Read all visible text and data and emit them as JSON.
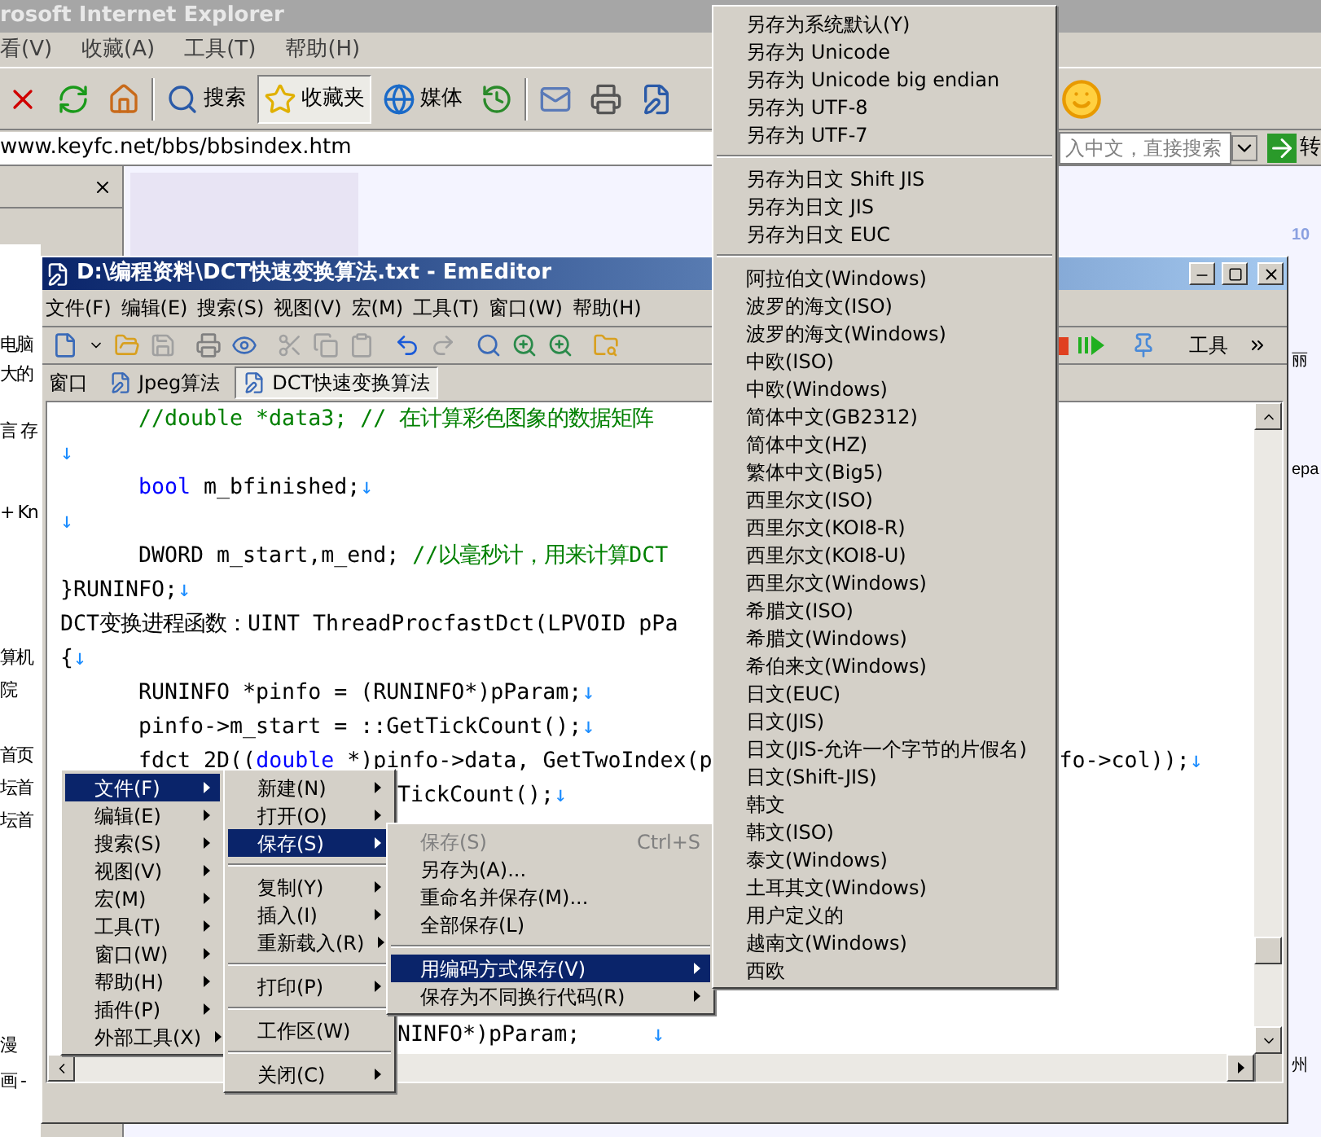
{
  "ie": {
    "title": "rosoft Internet Explorer",
    "menu": [
      "看(V)",
      "收藏(A)",
      "工具(T)",
      "帮助(H)"
    ],
    "toolbar": [
      {
        "kind": "stop"
      },
      {
        "kind": "refresh"
      },
      {
        "kind": "home"
      },
      {
        "kind": "separator"
      },
      {
        "kind": "search",
        "label": "搜索",
        "pressed": false
      },
      {
        "kind": "favorites",
        "label": "收藏夹",
        "pressed": true
      },
      {
        "kind": "media",
        "label": "媒体",
        "pressed": false
      },
      {
        "kind": "history"
      },
      {
        "kind": "separator"
      },
      {
        "kind": "mail"
      },
      {
        "kind": "print"
      },
      {
        "kind": "edit"
      }
    ],
    "address": "www.keyfc.net/bbs/bbsindex.htm",
    "search": {
      "placeholder": "入中文，直接搜索"
    },
    "go": "转",
    "left_fragments": [
      "电脑",
      "大的",
      "言 存",
      "+ Kn",
      "算机",
      "院",
      "首页",
      "坛首",
      "坛首",
      "漫",
      "画 -"
    ],
    "right_fragments": [
      "10",
      "丽",
      "epa",
      "州"
    ]
  },
  "editor": {
    "title": "D:\\编程资料\\DCT快速变换算法.txt - EmEditor",
    "menu": [
      "文件(F)",
      "编辑(E)",
      "搜索(S)",
      "视图(V)",
      "宏(M)",
      "工具(T)",
      "窗口(W)",
      "帮助(H)"
    ],
    "toolbar_label": "工具",
    "window_label": "窗口",
    "tabs": [
      {
        "label": "Jpeg算法",
        "selected": false
      },
      {
        "label": "DCT快速变换算法",
        "selected": true
      }
    ],
    "lines": [
      [
        {
          "kind": "indent"
        },
        {
          "kind": "comment",
          "text": "//double *data3; // 在计算彩色图象的数据矩阵"
        }
      ],
      [
        {
          "kind": "mark",
          "text": "↓"
        }
      ],
      [
        {
          "kind": "indent"
        },
        {
          "kind": "keyword",
          "text": "bool"
        },
        {
          "kind": "plain",
          "text": " m_bfinished;"
        },
        {
          "kind": "mark",
          "text": "↓"
        }
      ],
      [
        {
          "kind": "mark",
          "text": "↓"
        }
      ],
      [
        {
          "kind": "indent"
        },
        {
          "kind": "plain",
          "text": "DWORD m_start,m_end;"
        },
        {
          "kind": "comment",
          "text": " //以毫秒计，用来计算DCT"
        }
      ],
      [
        {
          "kind": "plain",
          "text": "}RUNINFO;"
        },
        {
          "kind": "mark",
          "text": "↓"
        }
      ],
      [
        {
          "kind": "plain",
          "text": "DCT变换进程函数：UINT ThreadProcfastDct(LPVOID pPa"
        }
      ],
      [
        {
          "kind": "plain",
          "text": "{"
        },
        {
          "kind": "mark",
          "text": "↓"
        }
      ],
      [
        {
          "kind": "indent"
        },
        {
          "kind": "plain",
          "text": "RUNINFO *pinfo = (RUNINFO*)pParam;"
        },
        {
          "kind": "mark",
          "text": "↓"
        }
      ],
      [
        {
          "kind": "indent"
        },
        {
          "kind": "plain",
          "text": "pinfo->m_start = ::GetTickCount();"
        },
        {
          "kind": "mark",
          "text": "↓"
        }
      ],
      [
        {
          "kind": "indent"
        },
        {
          "kind": "plain",
          "text": "fdct_2D(("
        },
        {
          "kind": "keyword",
          "text": "double"
        },
        {
          "kind": "plain",
          "text": " *)pinfo->data, GetTwoIndex(p"
        },
        {
          "kind": "gap"
        },
        {
          "kind": "plain",
          "text": "fo->col));"
        },
        {
          "kind": "mark",
          "text": "↓"
        }
      ],
      [
        {
          "kind": "hidden"
        },
        {
          "kind": "plain",
          "text": "TickCount();"
        },
        {
          "kind": "mark",
          "text": "↓"
        }
      ]
    ],
    "lower_lines": [
      [
        {
          "kind": "hidden"
        },
        {
          "kind": "plain",
          "text": "NINFO*)pParam;"
        },
        {
          "kind": "tab"
        },
        {
          "kind": "mark",
          "text": "↓"
        }
      ]
    ]
  },
  "menus": [
    {
      "kind": "main",
      "items": [
        {
          "kind": "item",
          "label": "文件(F)",
          "submenu": true,
          "selected": true
        },
        {
          "kind": "item",
          "label": "编辑(E)",
          "submenu": true,
          "selected": false
        },
        {
          "kind": "item",
          "label": "搜索(S)",
          "submenu": true,
          "selected": false
        },
        {
          "kind": "item",
          "label": "视图(V)",
          "submenu": true,
          "selected": false
        },
        {
          "kind": "item",
          "label": "宏(M)",
          "submenu": true,
          "selected": false
        },
        {
          "kind": "item",
          "label": "工具(T)",
          "submenu": true,
          "selected": false
        },
        {
          "kind": "item",
          "label": "窗口(W)",
          "submenu": true,
          "selected": false
        },
        {
          "kind": "item",
          "label": "帮助(H)",
          "submenu": true,
          "selected": false
        },
        {
          "kind": "item",
          "label": "插件(P)",
          "submenu": true,
          "selected": false
        },
        {
          "kind": "item",
          "label": "外部工具(X)",
          "submenu": true,
          "selected": false
        }
      ]
    },
    {
      "kind": "file",
      "items": [
        {
          "kind": "item",
          "label": "新建(N)",
          "submenu": true,
          "selected": false
        },
        {
          "kind": "item",
          "label": "打开(O)",
          "submenu": true,
          "selected": false
        },
        {
          "kind": "item",
          "label": "保存(S)",
          "submenu": true,
          "selected": true
        },
        {
          "kind": "separator"
        },
        {
          "kind": "item",
          "label": "复制(Y)",
          "submenu": true,
          "selected": false
        },
        {
          "kind": "item",
          "label": "插入(I)",
          "submenu": true,
          "selected": false
        },
        {
          "kind": "item",
          "label": "重新载入(R)",
          "submenu": true,
          "selected": false
        },
        {
          "kind": "separator"
        },
        {
          "kind": "item",
          "label": "打印(P)",
          "submenu": true,
          "selected": false
        },
        {
          "kind": "separator"
        },
        {
          "kind": "item",
          "label": "工作区(W)",
          "submenu": false,
          "selected": false
        },
        {
          "kind": "separator"
        },
        {
          "kind": "item",
          "label": "关闭(C)",
          "submenu": true,
          "selected": false
        }
      ]
    },
    {
      "kind": "save",
      "items": [
        {
          "kind": "item",
          "label": "保存(S)",
          "shortcut": "Ctrl+S",
          "submenu": false,
          "selected": false,
          "disabled": true
        },
        {
          "kind": "item",
          "label": "另存为(A)...",
          "submenu": false,
          "selected": false,
          "disabled": false
        },
        {
          "kind": "item",
          "label": "重命名并保存(M)...",
          "submenu": false,
          "selected": false,
          "disabled": false
        },
        {
          "kind": "item",
          "label": "全部保存(L)",
          "submenu": false,
          "selected": false,
          "disabled": false
        },
        {
          "kind": "separator"
        },
        {
          "kind": "item",
          "label": "用编码方式保存(V)",
          "submenu": true,
          "selected": true,
          "disabled": false
        },
        {
          "kind": "item",
          "label": "保存为不同换行代码(R)",
          "submenu": true,
          "selected": false,
          "disabled": false
        }
      ]
    },
    {
      "kind": "encoding",
      "items": [
        {
          "kind": "item",
          "label": "另存为系统默认(Y)",
          "selected": false
        },
        {
          "kind": "item",
          "label": "另存为 Unicode",
          "selected": false
        },
        {
          "kind": "item",
          "label": "另存为 Unicode big endian",
          "selected": false
        },
        {
          "kind": "item",
          "label": "另存为 UTF-8",
          "selected": false
        },
        {
          "kind": "item",
          "label": "另存为 UTF-7",
          "selected": false
        },
        {
          "kind": "separator"
        },
        {
          "kind": "item",
          "label": "另存为日文 Shift JIS",
          "selected": false
        },
        {
          "kind": "item",
          "label": "另存为日文 JIS",
          "selected": false
        },
        {
          "kind": "item",
          "label": "另存为日文 EUC",
          "selected": false
        },
        {
          "kind": "separator"
        },
        {
          "kind": "item",
          "label": "阿拉伯文(Windows)",
          "selected": false
        },
        {
          "kind": "item",
          "label": "波罗的海文(ISO)",
          "selected": false
        },
        {
          "kind": "item",
          "label": "波罗的海文(Windows)",
          "selected": false
        },
        {
          "kind": "item",
          "label": "中欧(ISO)",
          "selected": false
        },
        {
          "kind": "item",
          "label": "中欧(Windows)",
          "selected": false
        },
        {
          "kind": "item",
          "label": "简体中文(GB2312)",
          "selected": false
        },
        {
          "kind": "item",
          "label": "简体中文(HZ)",
          "selected": false
        },
        {
          "kind": "item",
          "label": "繁体中文(Big5)",
          "selected": false
        },
        {
          "kind": "item",
          "label": "西里尔文(ISO)",
          "selected": false
        },
        {
          "kind": "item",
          "label": "西里尔文(KOI8-R)",
          "selected": false
        },
        {
          "kind": "item",
          "label": "西里尔文(KOI8-U)",
          "selected": false
        },
        {
          "kind": "item",
          "label": "西里尔文(Windows)",
          "selected": false
        },
        {
          "kind": "item",
          "label": "希腊文(ISO)",
          "selected": false
        },
        {
          "kind": "item",
          "label": "希腊文(Windows)",
          "selected": false
        },
        {
          "kind": "item",
          "label": "希伯来文(Windows)",
          "selected": false
        },
        {
          "kind": "item",
          "label": "日文(EUC)",
          "selected": false
        },
        {
          "kind": "item",
          "label": "日文(JIS)",
          "selected": false
        },
        {
          "kind": "item",
          "label": "日文(JIS-允许一个字节的片假名)",
          "selected": false
        },
        {
          "kind": "item",
          "label": "日文(Shift-JIS)",
          "selected": false
        },
        {
          "kind": "item",
          "label": "韩文",
          "selected": false
        },
        {
          "kind": "item",
          "label": "韩文(ISO)",
          "selected": false
        },
        {
          "kind": "item",
          "label": "泰文(Windows)",
          "selected": false
        },
        {
          "kind": "item",
          "label": "土耳其文(Windows)",
          "selected": false
        },
        {
          "kind": "item",
          "label": "用户定义的",
          "selected": false
        },
        {
          "kind": "item",
          "label": "越南文(Windows)",
          "selected": false
        },
        {
          "kind": "item",
          "label": "西欧",
          "selected": false
        }
      ]
    }
  ]
}
